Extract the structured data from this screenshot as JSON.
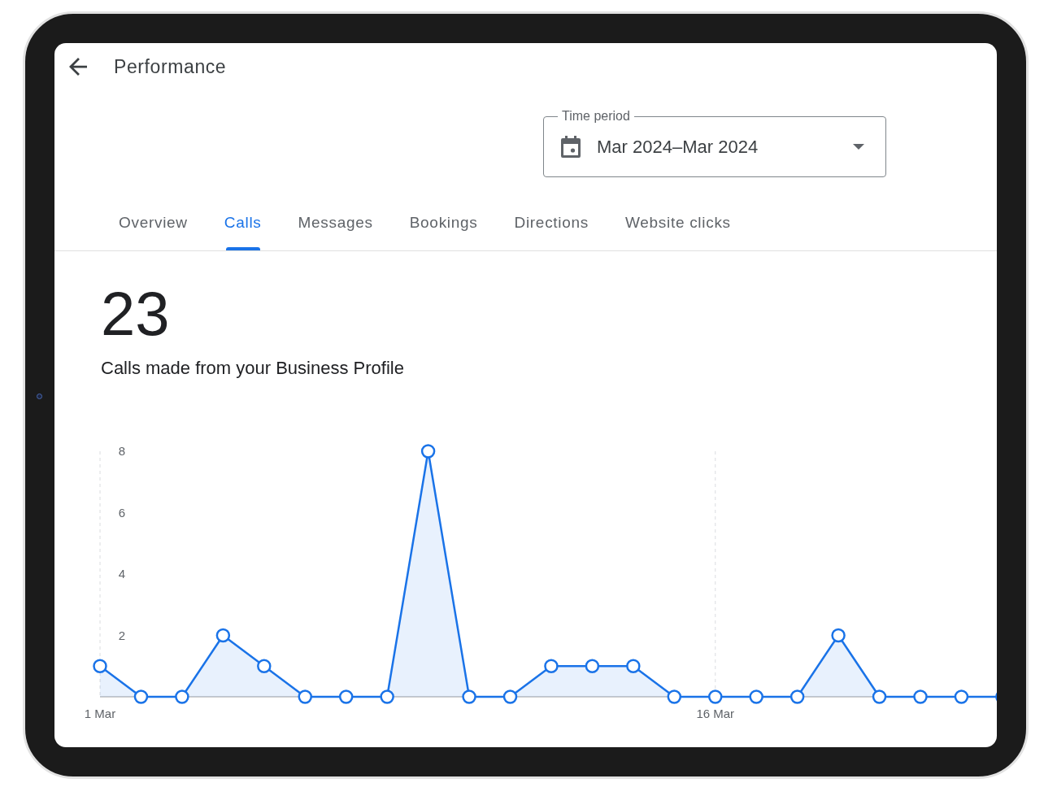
{
  "header": {
    "title": "Performance"
  },
  "time_period": {
    "label": "Time period",
    "value": "Mar 2024–Mar 2024"
  },
  "tabs": [
    {
      "label": "Overview",
      "selected": false
    },
    {
      "label": "Calls",
      "selected": true
    },
    {
      "label": "Messages",
      "selected": false
    },
    {
      "label": "Bookings",
      "selected": false
    },
    {
      "label": "Directions",
      "selected": false
    },
    {
      "label": "Website clicks",
      "selected": false
    }
  ],
  "summary": {
    "value": "23",
    "caption": "Calls made from your Business Profile"
  },
  "chart": {
    "chart_data": {
      "type": "area",
      "categories": [
        "1 Mar",
        null,
        null,
        null,
        null,
        null,
        null,
        null,
        null,
        null,
        null,
        null,
        null,
        null,
        null,
        "16 Mar",
        null,
        null,
        null,
        null,
        null,
        null,
        null
      ],
      "ylim": [
        0,
        8
      ],
      "yticks": [
        2,
        4,
        6,
        8
      ],
      "series": [
        {
          "color": "#1a73e8",
          "values": [
            1,
            0,
            0,
            2,
            1,
            0,
            0,
            0,
            8,
            0,
            0,
            1,
            1,
            1,
            0,
            0,
            0,
            0,
            2,
            0,
            0,
            0,
            0
          ]
        }
      ]
    }
  }
}
